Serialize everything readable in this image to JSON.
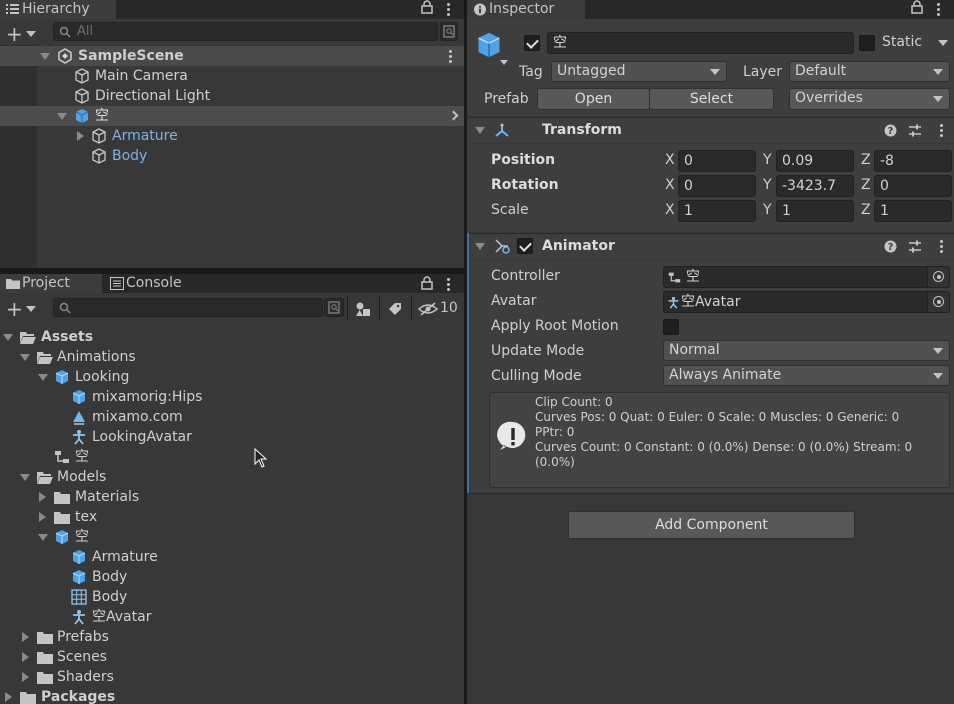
{
  "hierarchy": {
    "tab_label": "Hierarchy",
    "search_placeholder": "All",
    "scene": "SampleScene",
    "items": [
      {
        "label": "Main Camera"
      },
      {
        "label": "Directional Light"
      },
      {
        "label": "空"
      },
      {
        "label": "Armature"
      },
      {
        "label": "Body"
      }
    ]
  },
  "project": {
    "tabs": [
      "Project",
      "Console"
    ],
    "hidden_count": "10",
    "tree": [
      {
        "label": "Assets"
      },
      {
        "label": "Animations"
      },
      {
        "label": "Looking"
      },
      {
        "label": "mixamorig:Hips"
      },
      {
        "label": "mixamo.com"
      },
      {
        "label": "LookingAvatar"
      },
      {
        "label": "空"
      },
      {
        "label": "Models"
      },
      {
        "label": "Materials"
      },
      {
        "label": "tex"
      },
      {
        "label": "空"
      },
      {
        "label": "Armature"
      },
      {
        "label": "Body"
      },
      {
        "label": "Body"
      },
      {
        "label": "空Avatar"
      },
      {
        "label": "Prefabs"
      },
      {
        "label": "Scenes"
      },
      {
        "label": "Shaders"
      },
      {
        "label": "Packages"
      }
    ]
  },
  "inspector": {
    "tab_label": "Inspector",
    "object_name": "空",
    "static_label": "Static",
    "tag_label": "Tag",
    "tag_value": "Untagged",
    "layer_label": "Layer",
    "layer_value": "Default",
    "prefab_label": "Prefab",
    "open_label": "Open",
    "select_label": "Select",
    "overrides_label": "Overrides",
    "transform": {
      "title": "Transform",
      "rows": [
        {
          "label": "Position",
          "x": "0",
          "y": "0.09",
          "z": "-8"
        },
        {
          "label": "Rotation",
          "x": "0",
          "y": "-3423.7",
          "z": "0"
        },
        {
          "label": "Scale",
          "x": "1",
          "y": "1",
          "z": "1"
        }
      ]
    },
    "animator": {
      "title": "Animator",
      "controller_label": "Controller",
      "controller_value": "空",
      "avatar_label": "Avatar",
      "avatar_value": "空Avatar",
      "apply_root_motion_label": "Apply Root Motion",
      "update_mode_label": "Update Mode",
      "update_mode_value": "Normal",
      "culling_mode_label": "Culling Mode",
      "culling_mode_value": "Always Animate",
      "info_lines": [
        "Clip Count: 0",
        "Curves Pos: 0 Quat: 0 Euler: 0 Scale: 0 Muscles: 0 Generic: 0",
        "PPtr: 0",
        "Curves Count: 0 Constant: 0 (0.0%) Dense: 0 (0.0%) Stream: 0",
        "(0.0%)"
      ]
    },
    "add_component_label": "Add Component"
  },
  "colors": {
    "panel": "#383838",
    "selection": "#4d4d4d",
    "prefab_blue": "#7fb2e6",
    "accent_bar": "#3d6fa8"
  }
}
